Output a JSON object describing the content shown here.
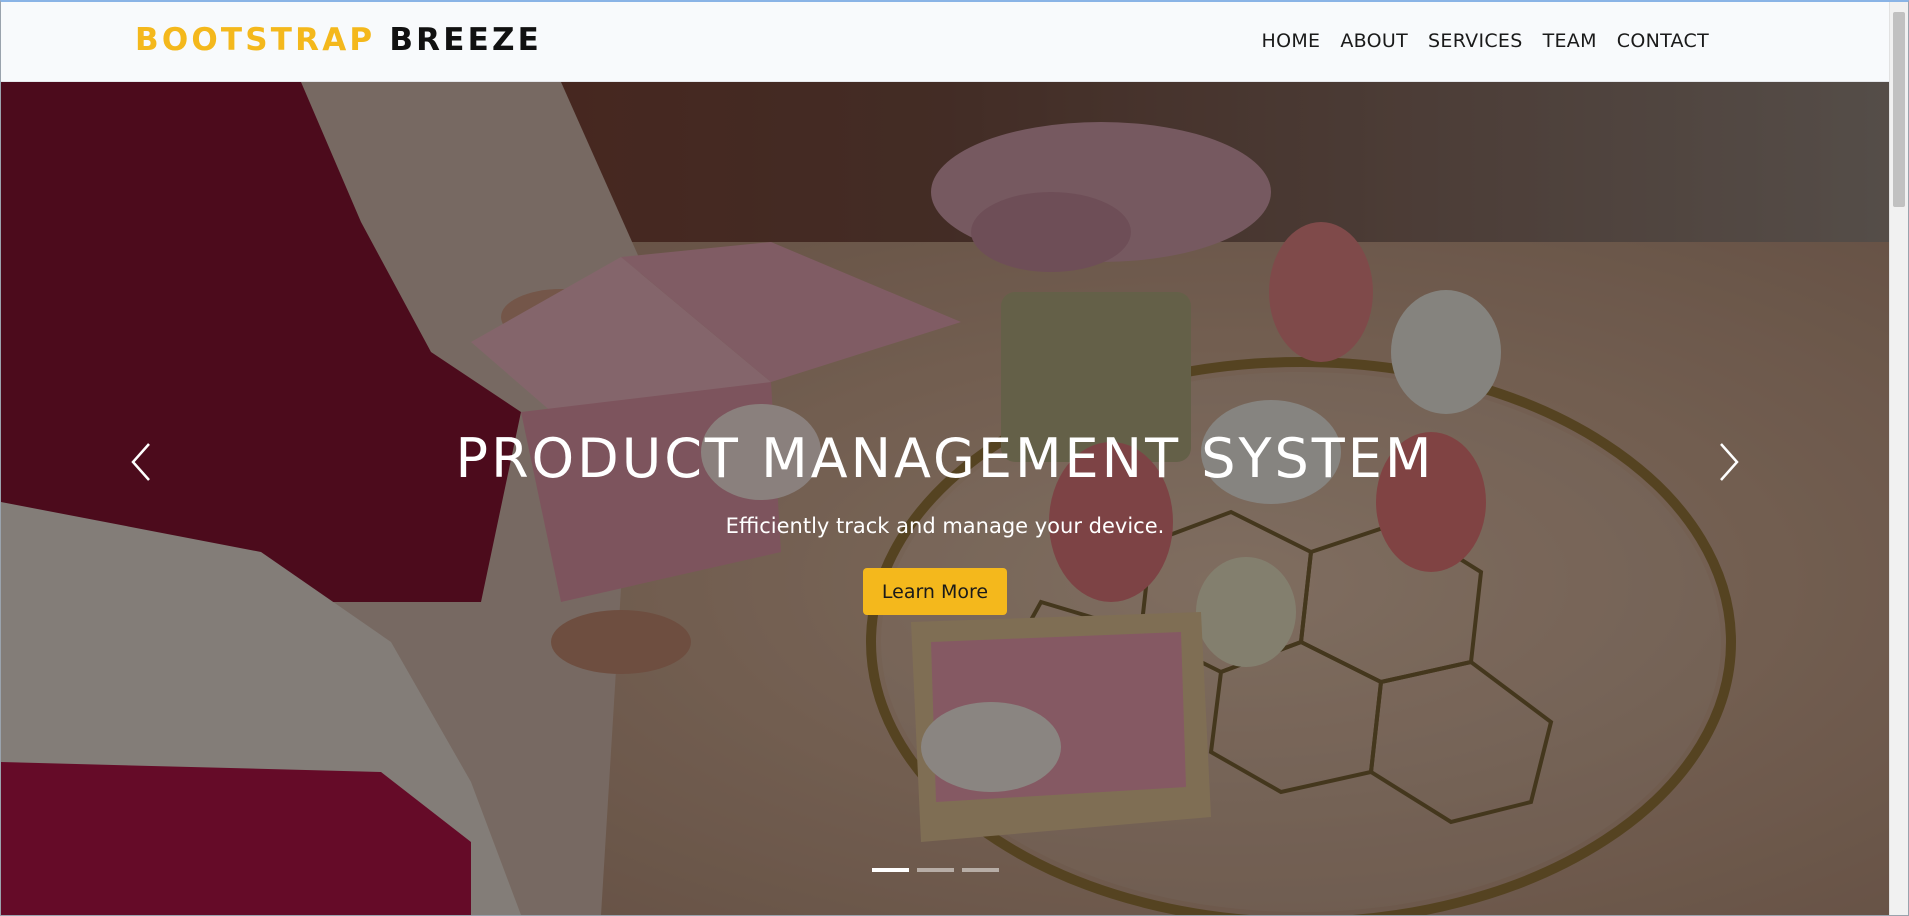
{
  "brand": {
    "part1": "BOOTSTRAP",
    "part2": "BREEZE"
  },
  "nav": {
    "items": [
      {
        "label": "HOME"
      },
      {
        "label": "ABOUT"
      },
      {
        "label": "SERVICES"
      },
      {
        "label": "TEAM"
      },
      {
        "label": "CONTACT"
      }
    ]
  },
  "hero": {
    "title": "PRODUCT MANAGEMENT SYSTEM",
    "subtitle": "Efficiently track and manage your device.",
    "button_label": "Learn More",
    "prev_icon": "chevron-left-icon",
    "next_icon": "chevron-right-icon",
    "slide_count": 3,
    "active_slide": 1
  },
  "colors": {
    "accent": "#f4b81c",
    "brand_dark": "#111111",
    "navbar_bg": "#f8fafc"
  }
}
